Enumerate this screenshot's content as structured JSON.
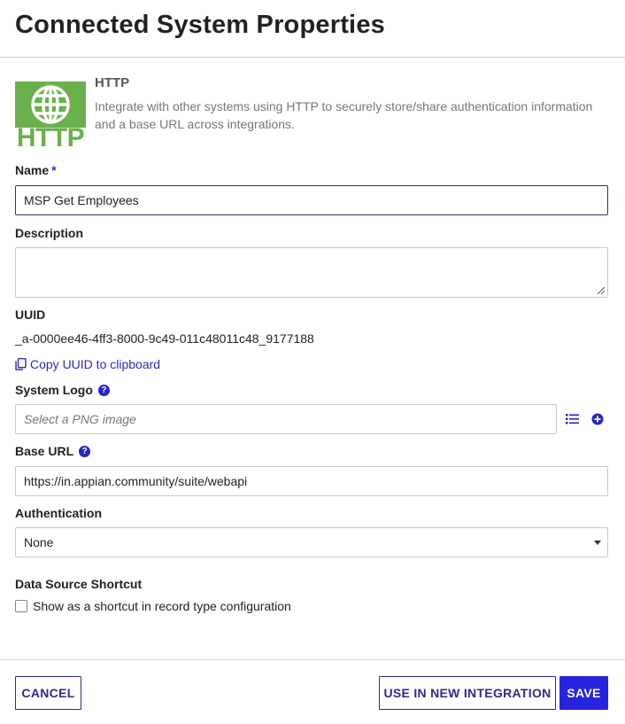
{
  "dialog": {
    "title": "Connected System Properties"
  },
  "system": {
    "name": "HTTP",
    "logo_text": "HTTP",
    "description": "Integrate with other systems using HTTP to securely store/share authentication information and a base URL across integrations."
  },
  "fields": {
    "name": {
      "label": "Name",
      "required_mark": "*",
      "value": "MSP Get Employees"
    },
    "description": {
      "label": "Description",
      "value": ""
    },
    "uuid": {
      "label": "UUID",
      "value": "_a-0000ee46-4ff3-8000-9c49-011c48011c48_9177188",
      "copy_label": "Copy UUID to clipboard"
    },
    "system_logo": {
      "label": "System Logo",
      "placeholder": "Select a PNG image"
    },
    "base_url": {
      "label": "Base URL",
      "value": "https://in.appian.community/suite/webapi"
    },
    "authentication": {
      "label": "Authentication",
      "value": "None"
    },
    "data_source_shortcut": {
      "label": "Data Source Shortcut",
      "checkbox_label": "Show as a shortcut in record type configuration",
      "checked": false
    }
  },
  "footer": {
    "cancel_label": "CANCEL",
    "use_label": "USE IN NEW INTEGRATION",
    "save_label": "SAVE"
  },
  "colors": {
    "accent": "#2525e0",
    "logo_green": "#6ab04c",
    "link": "#2b2bb8"
  }
}
